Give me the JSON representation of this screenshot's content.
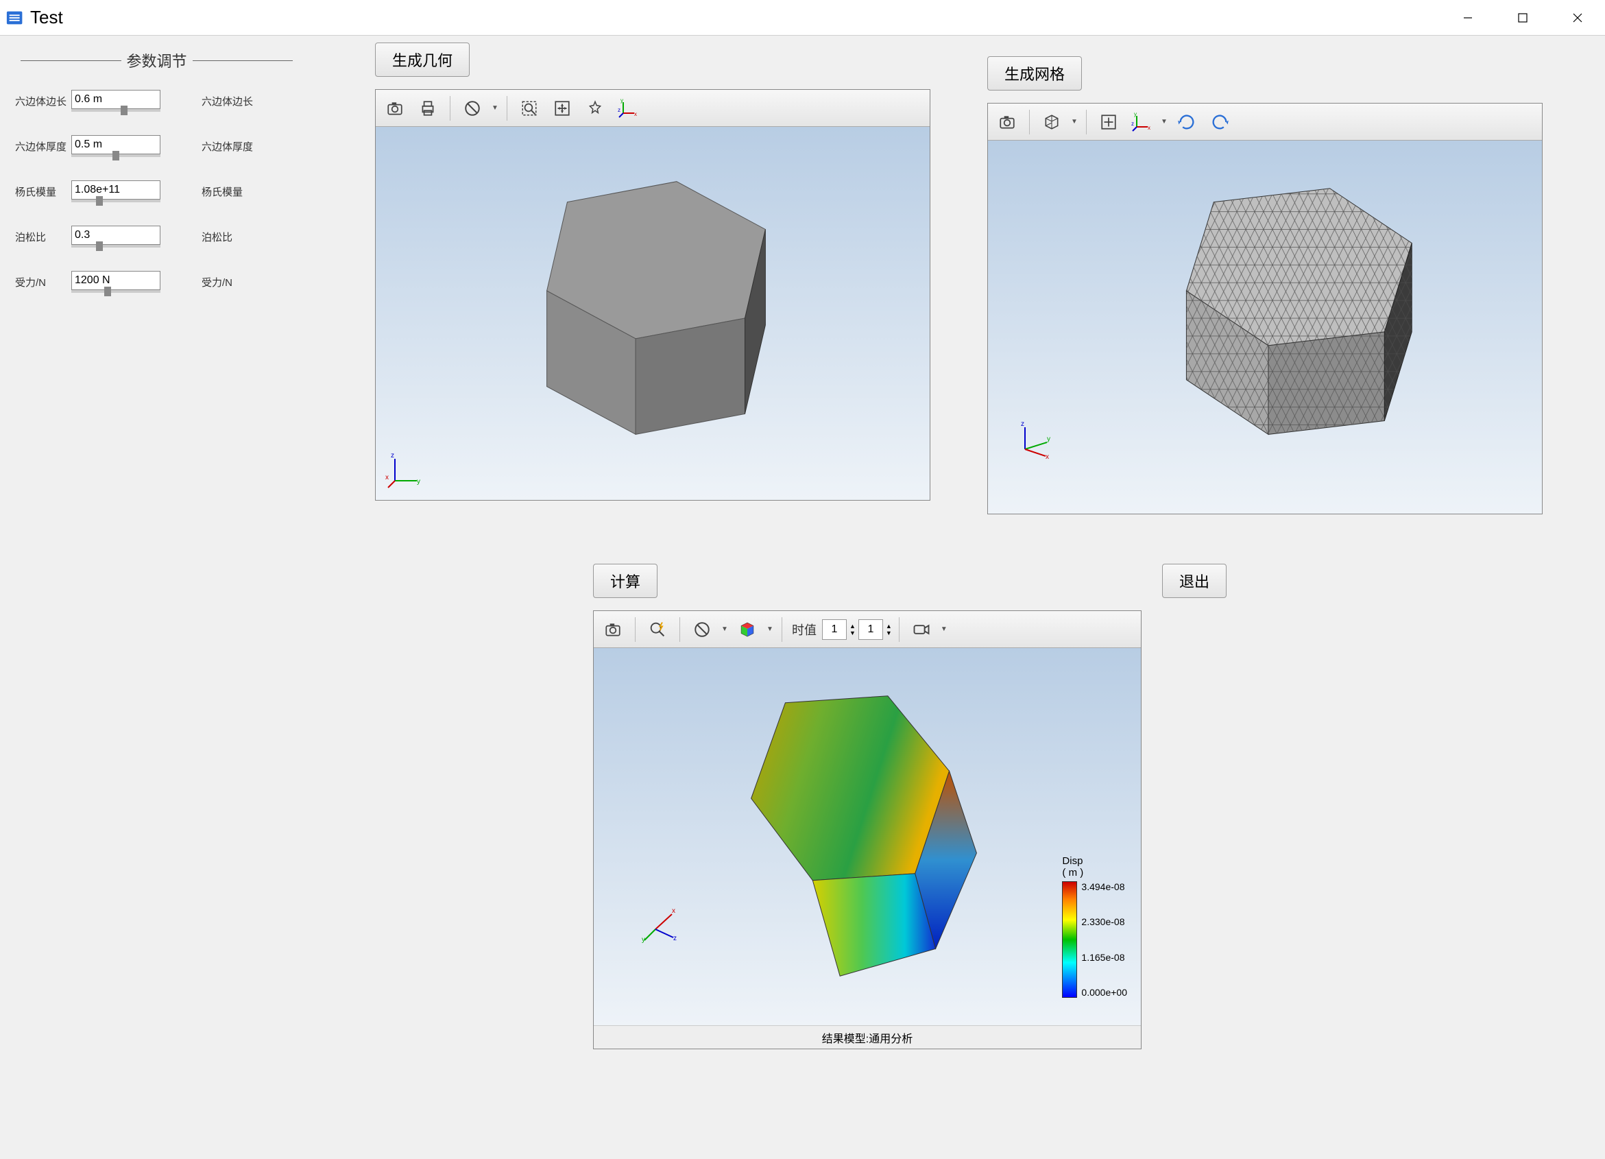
{
  "window": {
    "title": "Test"
  },
  "sidebar": {
    "heading": "参数调节",
    "params": [
      {
        "label_left": "六边体边长",
        "value": "0.6  m",
        "label_right": "六边体边长"
      },
      {
        "label_left": "六边体厚度",
        "value": "0.5  m",
        "label_right": "六边体厚度"
      },
      {
        "label_left": "杨氏模量",
        "value": "1.08e+11",
        "label_right": "杨氏模量"
      },
      {
        "label_left": "泊松比",
        "value": "0.3",
        "label_right": "泊松比"
      },
      {
        "label_left": "受力/N",
        "value": "1200  N",
        "label_right": "受力/N"
      }
    ]
  },
  "buttons": {
    "generate_geometry": "生成几何",
    "generate_mesh": "生成网格",
    "compute": "计算",
    "exit": "退出"
  },
  "result_toolbar": {
    "time_label": "时值",
    "time_value": "1",
    "step_value": "1"
  },
  "result": {
    "footer": "结果模型:通用分析",
    "legend_title_line1": "Disp",
    "legend_title_line2": "( m )",
    "legend_ticks": [
      "3.494e-08",
      "2.330e-08",
      "1.165e-08",
      "0.000e+00"
    ]
  }
}
